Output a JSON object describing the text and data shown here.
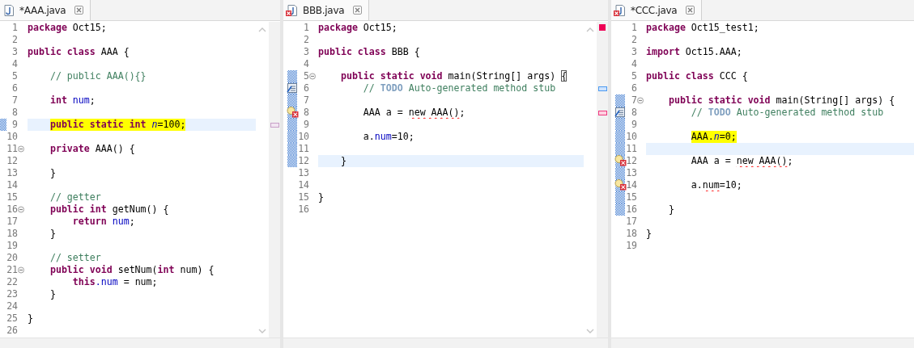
{
  "editors": [
    {
      "tab": {
        "title": "*AAA.java",
        "has_error": false
      },
      "vertical_scrollbar": true,
      "error_summary": false,
      "lines": [
        {
          "number": "1",
          "current": false,
          "highlighted": false,
          "foldable": false,
          "in_range": false,
          "tokens": [
            {
              "text": "package",
              "kind": "keyword"
            },
            {
              "text": " Oct15;",
              "kind": "plain"
            }
          ]
        },
        {
          "number": "2",
          "current": false,
          "highlighted": false,
          "foldable": false,
          "in_range": false
        },
        {
          "number": "3",
          "current": false,
          "highlighted": false,
          "foldable": false,
          "in_range": false,
          "tokens": [
            {
              "text": "public class",
              "kind": "keyword"
            },
            {
              "text": " AAA {",
              "kind": "plain"
            }
          ]
        },
        {
          "number": "4",
          "current": false,
          "highlighted": false,
          "foldable": false,
          "in_range": false
        },
        {
          "number": "5",
          "current": false,
          "highlighted": false,
          "foldable": false,
          "in_range": false,
          "tokens": [
            {
              "text": "    // public AAA(){}",
              "kind": "comment"
            }
          ]
        },
        {
          "number": "6",
          "current": false,
          "highlighted": false,
          "foldable": false,
          "in_range": false
        },
        {
          "number": "7",
          "current": false,
          "highlighted": false,
          "foldable": false,
          "in_range": false,
          "tokens": [
            {
              "text": "    int",
              "kind": "keyword"
            },
            {
              "text": " num",
              "kind": "field"
            },
            {
              "text": ";",
              "kind": "plain"
            }
          ]
        },
        {
          "number": "8",
          "current": false,
          "highlighted": false,
          "foldable": false,
          "in_range": false
        },
        {
          "number": "9",
          "current": true,
          "highlighted": true,
          "foldable": false,
          "in_range": true,
          "ruler_mark": {
            "kind": "occurrence"
          },
          "tokens": [
            {
              "text": "    public static int",
              "kind": "keyword"
            },
            {
              "text": " n",
              "kind": "static_field"
            },
            {
              "text": "=100;",
              "kind": "plain"
            }
          ]
        },
        {
          "number": "10",
          "current": false,
          "highlighted": false,
          "foldable": false,
          "in_range": false
        },
        {
          "number": "11",
          "current": false,
          "highlighted": false,
          "foldable": true,
          "in_range": false,
          "tokens": [
            {
              "text": "    private",
              "kind": "keyword"
            },
            {
              "text": " AAA() {",
              "kind": "plain"
            }
          ]
        },
        {
          "number": "12",
          "current": false,
          "highlighted": false,
          "foldable": false,
          "in_range": false
        },
        {
          "number": "13",
          "current": false,
          "highlighted": false,
          "foldable": false,
          "in_range": false,
          "tokens": [
            {
              "text": "    }",
              "kind": "plain"
            }
          ]
        },
        {
          "number": "14",
          "current": false,
          "highlighted": false,
          "foldable": false,
          "in_range": false
        },
        {
          "number": "15",
          "current": false,
          "highlighted": false,
          "foldable": false,
          "in_range": false,
          "tokens": [
            {
              "text": "    // getter",
              "kind": "comment"
            }
          ]
        },
        {
          "number": "16",
          "current": false,
          "highlighted": false,
          "foldable": true,
          "in_range": false,
          "tokens": [
            {
              "text": "    public int",
              "kind": "keyword"
            },
            {
              "text": " getNum() {",
              "kind": "plain"
            }
          ]
        },
        {
          "number": "17",
          "current": false,
          "highlighted": false,
          "foldable": false,
          "in_range": false,
          "tokens": [
            {
              "text": "        return",
              "kind": "keyword"
            },
            {
              "text": " num",
              "kind": "field"
            },
            {
              "text": ";",
              "kind": "plain"
            }
          ]
        },
        {
          "number": "18",
          "current": false,
          "highlighted": false,
          "foldable": false,
          "in_range": false,
          "tokens": [
            {
              "text": "    }",
              "kind": "plain"
            }
          ]
        },
        {
          "number": "19",
          "current": false,
          "highlighted": false,
          "foldable": false,
          "in_range": false
        },
        {
          "number": "20",
          "current": false,
          "highlighted": false,
          "foldable": false,
          "in_range": false,
          "tokens": [
            {
              "text": "    // setter",
              "kind": "comment"
            }
          ]
        },
        {
          "number": "21",
          "current": false,
          "highlighted": false,
          "foldable": true,
          "in_range": false,
          "tokens": [
            {
              "text": "    public void",
              "kind": "keyword"
            },
            {
              "text": " setNum(",
              "kind": "plain"
            },
            {
              "text": "int",
              "kind": "keyword"
            },
            {
              "text": " num) {",
              "kind": "plain"
            }
          ]
        },
        {
          "number": "22",
          "current": false,
          "highlighted": false,
          "foldable": false,
          "in_range": false,
          "tokens": [
            {
              "text": "        this",
              "kind": "keyword"
            },
            {
              "text": ".num",
              "kind": "field"
            },
            {
              "text": " = num;",
              "kind": "plain"
            }
          ]
        },
        {
          "number": "23",
          "current": false,
          "highlighted": false,
          "foldable": false,
          "in_range": false,
          "tokens": [
            {
              "text": "    }",
              "kind": "plain"
            }
          ]
        },
        {
          "number": "24",
          "current": false,
          "highlighted": false,
          "foldable": false,
          "in_range": false
        },
        {
          "number": "25",
          "current": false,
          "highlighted": false,
          "foldable": false,
          "in_range": false,
          "tokens": [
            {
              "text": "}",
              "kind": "plain"
            }
          ]
        },
        {
          "number": "26",
          "current": false,
          "highlighted": false,
          "foldable": false,
          "in_range": false
        }
      ]
    },
    {
      "tab": {
        "title": "BBB.java",
        "has_error": true
      },
      "vertical_scrollbar": true,
      "error_summary": true,
      "lines": [
        {
          "number": "1",
          "current": false,
          "highlighted": false,
          "foldable": false,
          "in_range": false,
          "tokens": [
            {
              "text": "package",
              "kind": "keyword"
            },
            {
              "text": " Oct15;",
              "kind": "plain"
            }
          ]
        },
        {
          "number": "2",
          "current": false,
          "highlighted": false,
          "foldable": false,
          "in_range": false
        },
        {
          "number": "3",
          "current": false,
          "highlighted": false,
          "foldable": false,
          "in_range": false,
          "tokens": [
            {
              "text": "public class",
              "kind": "keyword"
            },
            {
              "text": " BBB {",
              "kind": "plain"
            }
          ]
        },
        {
          "number": "4",
          "current": false,
          "highlighted": false,
          "foldable": false,
          "in_range": false
        },
        {
          "number": "5",
          "current": false,
          "highlighted": false,
          "foldable": true,
          "in_range": true,
          "tokens": [
            {
              "text": "    public static void",
              "kind": "keyword"
            },
            {
              "text": " main(String[] args) ",
              "kind": "plain"
            },
            {
              "text": "{",
              "kind": "bracket_match"
            }
          ]
        },
        {
          "number": "6",
          "current": false,
          "highlighted": false,
          "foldable": false,
          "in_range": true,
          "marker": {
            "kind": "task"
          },
          "ruler_mark": {
            "kind": "task"
          },
          "tokens": [
            {
              "text": "        // ",
              "kind": "comment"
            },
            {
              "text": "TODO",
              "kind": "todo"
            },
            {
              "text": " Auto-generated method stub",
              "kind": "comment"
            }
          ]
        },
        {
          "number": "7",
          "current": false,
          "highlighted": false,
          "foldable": false,
          "in_range": true
        },
        {
          "number": "8",
          "current": false,
          "highlighted": false,
          "foldable": false,
          "in_range": true,
          "marker": {
            "kind": "error"
          },
          "ruler_mark": {
            "kind": "error"
          },
          "tokens": [
            {
              "text": "        AAA a = ",
              "kind": "plain"
            },
            {
              "text": "new AAA()",
              "kind": "error"
            },
            {
              "text": ";",
              "kind": "plain"
            }
          ]
        },
        {
          "number": "9",
          "current": false,
          "highlighted": false,
          "foldable": false,
          "in_range": true
        },
        {
          "number": "10",
          "current": false,
          "highlighted": false,
          "foldable": false,
          "in_range": true,
          "tokens": [
            {
              "text": "        a.",
              "kind": "plain"
            },
            {
              "text": "num",
              "kind": "field"
            },
            {
              "text": "=10;",
              "kind": "plain"
            }
          ]
        },
        {
          "number": "11",
          "current": false,
          "highlighted": false,
          "foldable": false,
          "in_range": true
        },
        {
          "number": "12",
          "current": true,
          "highlighted": false,
          "foldable": false,
          "in_range": true,
          "tokens": [
            {
              "text": "    }",
              "kind": "plain"
            }
          ]
        },
        {
          "number": "13",
          "current": false,
          "highlighted": false,
          "foldable": false,
          "in_range": false
        },
        {
          "number": "14",
          "current": false,
          "highlighted": false,
          "foldable": false,
          "in_range": false
        },
        {
          "number": "15",
          "current": false,
          "highlighted": false,
          "foldable": false,
          "in_range": false,
          "tokens": [
            {
              "text": "}",
              "kind": "plain"
            }
          ]
        },
        {
          "number": "16",
          "current": false,
          "highlighted": false,
          "foldable": false,
          "in_range": false
        }
      ]
    },
    {
      "tab": {
        "title": "*CCC.java",
        "has_error": true
      },
      "vertical_scrollbar": false,
      "error_summary": false,
      "lines": [
        {
          "number": "1",
          "current": false,
          "highlighted": false,
          "foldable": false,
          "in_range": false,
          "tokens": [
            {
              "text": "package",
              "kind": "keyword"
            },
            {
              "text": " Oct15_test1;",
              "kind": "plain"
            }
          ]
        },
        {
          "number": "2",
          "current": false,
          "highlighted": false,
          "foldable": false,
          "in_range": false
        },
        {
          "number": "3",
          "current": false,
          "highlighted": false,
          "foldable": false,
          "in_range": false,
          "tokens": [
            {
              "text": "import",
              "kind": "keyword"
            },
            {
              "text": " Oct15.AAA;",
              "kind": "plain"
            }
          ]
        },
        {
          "number": "4",
          "current": false,
          "highlighted": false,
          "foldable": false,
          "in_range": false
        },
        {
          "number": "5",
          "current": false,
          "highlighted": false,
          "foldable": false,
          "in_range": false,
          "tokens": [
            {
              "text": "public class",
              "kind": "keyword"
            },
            {
              "text": " CCC {",
              "kind": "plain"
            }
          ]
        },
        {
          "number": "6",
          "current": false,
          "highlighted": false,
          "foldable": false,
          "in_range": false
        },
        {
          "number": "7",
          "current": false,
          "highlighted": false,
          "foldable": true,
          "in_range": true,
          "tokens": [
            {
              "text": "    public static void",
              "kind": "keyword"
            },
            {
              "text": " main(String[] args) {",
              "kind": "plain"
            }
          ]
        },
        {
          "number": "8",
          "current": false,
          "highlighted": false,
          "foldable": false,
          "in_range": true,
          "marker": {
            "kind": "task"
          },
          "tokens": [
            {
              "text": "        // ",
              "kind": "comment"
            },
            {
              "text": "TODO",
              "kind": "todo"
            },
            {
              "text": " Auto-generated method stub",
              "kind": "comment"
            }
          ]
        },
        {
          "number": "9",
          "current": false,
          "highlighted": false,
          "foldable": false,
          "in_range": true
        },
        {
          "number": "10",
          "current": false,
          "highlighted": true,
          "foldable": false,
          "in_range": true,
          "tokens": [
            {
              "text": "        AAA.",
              "kind": "plain"
            },
            {
              "text": "n",
              "kind": "static_field"
            },
            {
              "text": "=0;",
              "kind": "plain"
            }
          ]
        },
        {
          "number": "11",
          "current": true,
          "highlighted": false,
          "foldable": false,
          "in_range": true
        },
        {
          "number": "12",
          "current": false,
          "highlighted": false,
          "foldable": false,
          "in_range": true,
          "marker": {
            "kind": "error"
          },
          "tokens": [
            {
              "text": "        AAA a = ",
              "kind": "plain"
            },
            {
              "text": "new AAA()",
              "kind": "error"
            },
            {
              "text": ";",
              "kind": "plain"
            }
          ]
        },
        {
          "number": "13",
          "current": false,
          "highlighted": false,
          "foldable": false,
          "in_range": true
        },
        {
          "number": "14",
          "current": false,
          "highlighted": false,
          "foldable": false,
          "in_range": true,
          "marker": {
            "kind": "error"
          },
          "tokens": [
            {
              "text": "        a.",
              "kind": "plain"
            },
            {
              "text": "num",
              "kind": "error"
            },
            {
              "text": "=10;",
              "kind": "plain"
            }
          ]
        },
        {
          "number": "15",
          "current": false,
          "highlighted": false,
          "foldable": false,
          "in_range": true
        },
        {
          "number": "16",
          "current": false,
          "highlighted": false,
          "foldable": false,
          "in_range": true,
          "tokens": [
            {
              "text": "    }",
              "kind": "plain"
            }
          ]
        },
        {
          "number": "17",
          "current": false,
          "highlighted": false,
          "foldable": false,
          "in_range": false
        },
        {
          "number": "18",
          "current": false,
          "highlighted": false,
          "foldable": false,
          "in_range": false,
          "tokens": [
            {
              "text": "}",
              "kind": "plain"
            }
          ]
        },
        {
          "number": "19",
          "current": false,
          "highlighted": false,
          "foldable": false,
          "in_range": false
        }
      ]
    }
  ]
}
